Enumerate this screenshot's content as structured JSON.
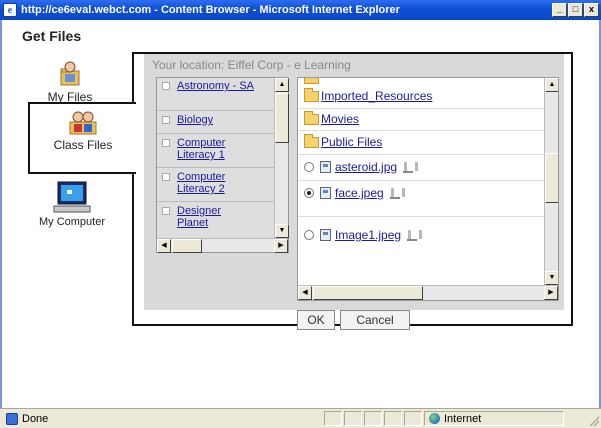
{
  "window": {
    "title": "http://ce6eval.webct.com - Content Browser - Microsoft Internet Explorer",
    "minimize": "_",
    "maximize": "□",
    "close": "x"
  },
  "heading": "Get Files",
  "locations": [
    {
      "label": "My Files",
      "icon": "my-files-icon"
    },
    {
      "label": "Class Files",
      "icon": "class-files-icon",
      "selected": true
    },
    {
      "label": "My Computer",
      "icon": "my-computer-icon"
    }
  ],
  "current_location": "Your location: Eiffel Corp - e Learning",
  "tree": [
    "Astronomy - SA",
    "Biology",
    "Computer Literacy 1",
    "Computer Literacy 2",
    "Designer Planet"
  ],
  "folders": [
    "Imported_Resources",
    "Movies",
    "Public Files"
  ],
  "files": [
    {
      "name": "asteroid.jpg",
      "selected": false
    },
    {
      "name": "face.jpeg",
      "selected": true
    },
    {
      "name": "Image1.jpeg",
      "selected": false
    }
  ],
  "buttons": {
    "ok": "OK",
    "cancel": "Cancel"
  },
  "status": {
    "text": "Done",
    "zone": "Internet"
  },
  "colors": {
    "titlebar": "#0a46c8",
    "link": "#1a1aa0",
    "panel_bg": "#d9d9d9"
  }
}
